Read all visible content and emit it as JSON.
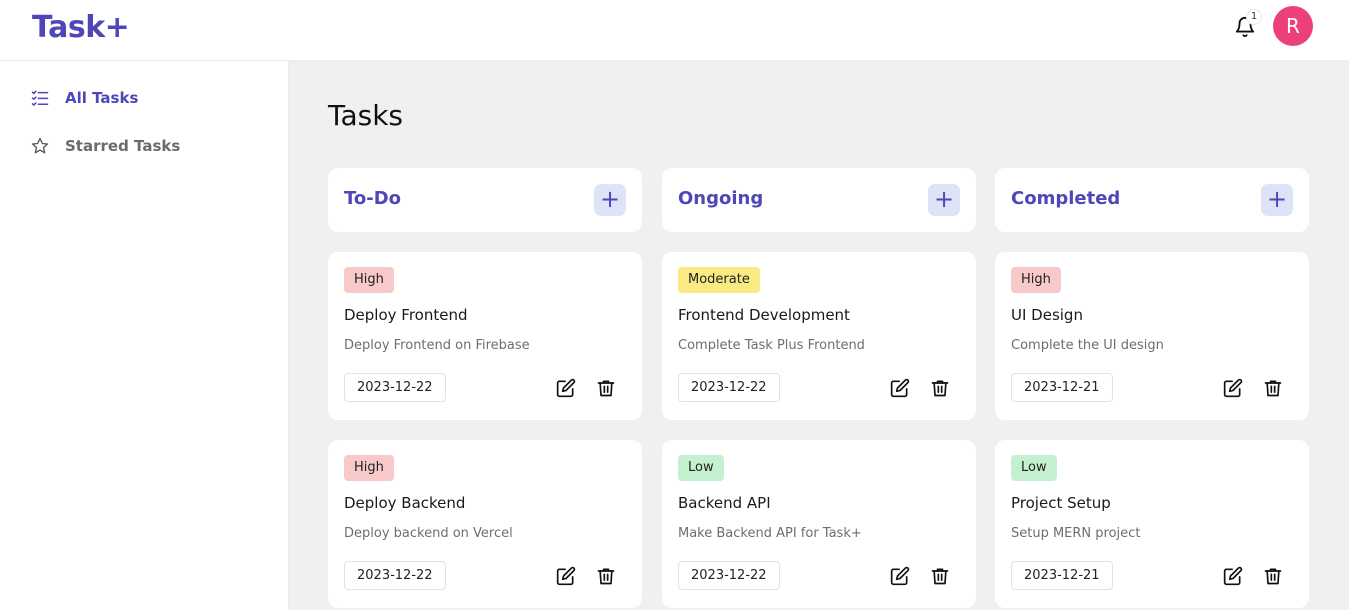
{
  "app": {
    "logo": "Task+",
    "notification_count": "1",
    "avatar_initial": "R",
    "brand_color": "#4f46b8",
    "avatar_color": "#ec407a"
  },
  "sidebar": {
    "items": [
      {
        "label": "All Tasks",
        "icon": "checklist-icon",
        "active": true
      },
      {
        "label": "Starred Tasks",
        "icon": "star-icon",
        "active": false
      }
    ]
  },
  "main": {
    "title": "Tasks",
    "columns": [
      {
        "title": "To-Do",
        "add_label": "+",
        "cards": [
          {
            "priority": "High",
            "title": "Deploy Frontend",
            "description": "Deploy Frontend on Firebase",
            "date": "2023-12-22"
          },
          {
            "priority": "High",
            "title": "Deploy Backend",
            "description": "Deploy backend on Vercel",
            "date": "2023-12-22"
          }
        ]
      },
      {
        "title": "Ongoing",
        "add_label": "+",
        "cards": [
          {
            "priority": "Moderate",
            "title": "Frontend Development",
            "description": "Complete Task Plus Frontend",
            "date": "2023-12-22"
          },
          {
            "priority": "Low",
            "title": "Backend API",
            "description": "Make Backend API for Task+",
            "date": "2023-12-22"
          }
        ]
      },
      {
        "title": "Completed",
        "add_label": "+",
        "cards": [
          {
            "priority": "High",
            "title": "UI Design",
            "description": "Complete the UI design",
            "date": "2023-12-21"
          },
          {
            "priority": "Low",
            "title": "Project Setup",
            "description": "Setup MERN project",
            "date": "2023-12-21"
          }
        ]
      }
    ]
  },
  "priority_colors": {
    "High": "#f8c9c9",
    "Moderate": "#f9ea82",
    "Low": "#c4f0cf"
  }
}
